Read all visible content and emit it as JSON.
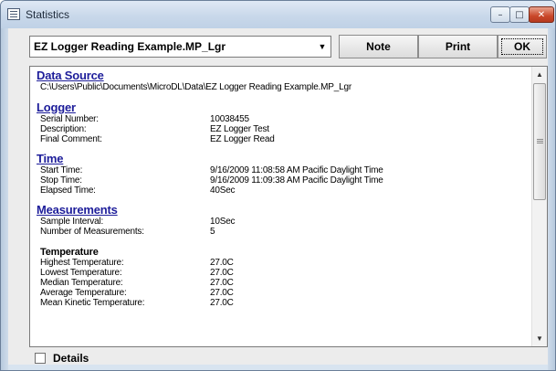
{
  "window": {
    "title": "Statistics",
    "controls": {
      "minimize": "–",
      "maximize": "□",
      "close": "✕"
    }
  },
  "toolbar": {
    "file_select": {
      "value": "EZ Logger Reading Example.MP_Lgr",
      "arrow": "▼"
    },
    "note_label": "Note",
    "print_label": "Print",
    "ok_label": "OK"
  },
  "report": {
    "data_source": {
      "title": "Data Source",
      "path": "C:\\Users\\Public\\Documents\\MicroDL\\Data\\EZ Logger Reading Example.MP_Lgr"
    },
    "logger": {
      "title": "Logger",
      "rows": [
        {
          "label": "Serial Number:",
          "value": "10038455"
        },
        {
          "label": "Description:",
          "value": "EZ Logger Test"
        },
        {
          "label": "Final Comment:",
          "value": "EZ Logger Read"
        }
      ]
    },
    "time": {
      "title": "Time",
      "rows": [
        {
          "label": "Start Time:",
          "value": "9/16/2009  11:08:58 AM  Pacific Daylight Time"
        },
        {
          "label": "Stop Time:",
          "value": "9/16/2009  11:09:38 AM  Pacific Daylight Time"
        },
        {
          "label": "Elapsed Time:",
          "value": "40Sec"
        }
      ]
    },
    "measurements": {
      "title": "Measurements",
      "rows": [
        {
          "label": "Sample Interval:",
          "value": "10Sec"
        },
        {
          "label": "Number of Measurements:",
          "value": "5"
        }
      ],
      "temperature": {
        "title": "Temperature",
        "rows": [
          {
            "label": "Highest Temperature:",
            "value": "27.0C"
          },
          {
            "label": "Lowest Temperature:",
            "value": "27.0C"
          },
          {
            "label": "Median Temperature:",
            "value": "27.0C"
          },
          {
            "label": "Average Temperature:",
            "value": "27.0C"
          },
          {
            "label": "Mean Kinetic Temperature:",
            "value": "27.0C"
          }
        ]
      }
    }
  },
  "scrollbar": {
    "up_arrow": "▲",
    "down_arrow": "▼",
    "position": 0.0
  },
  "details": {
    "label": "Details",
    "checked": false
  }
}
